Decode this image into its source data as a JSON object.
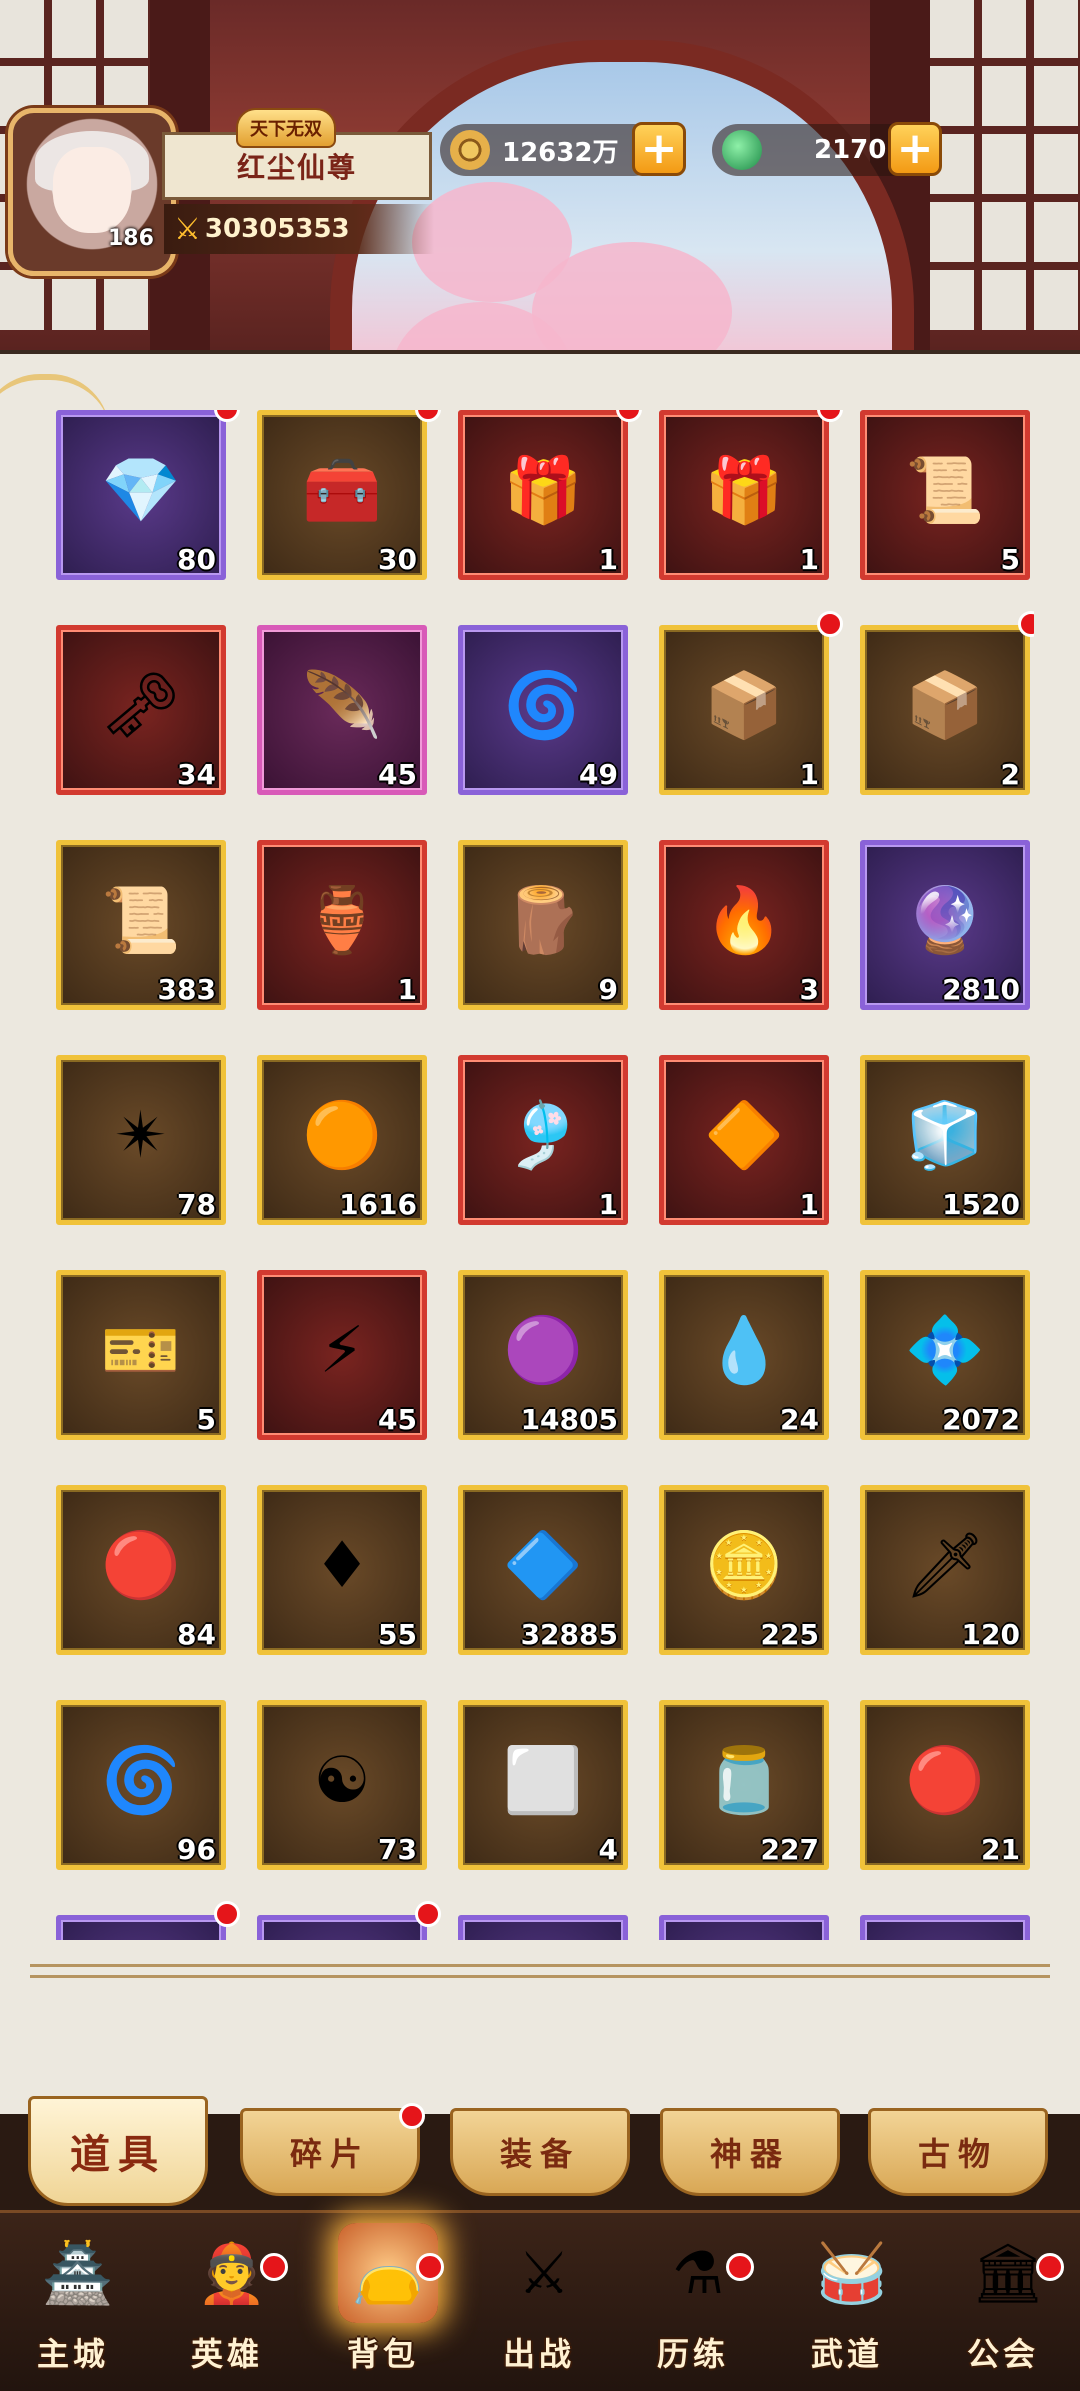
{
  "player": {
    "title_badge": "天下无双",
    "name": "红尘仙尊",
    "level": "186",
    "power": "30305353"
  },
  "currencies": [
    {
      "name": "copper-coin-icon",
      "value": "12632万",
      "color": "#c8902a"
    },
    {
      "name": "jade-icon",
      "value": "2170",
      "color": "#38b060"
    }
  ],
  "items": [
    {
      "icon": "purple-crystal-chest-icon",
      "glyph": "💎",
      "count": "80",
      "quality": "purple",
      "dot": true
    },
    {
      "icon": "gold-treasure-chest-icon",
      "glyph": "🧰",
      "count": "30",
      "quality": "gold",
      "dot": true
    },
    {
      "icon": "elite-god-chest-icon",
      "glyph": "🎁",
      "count": "1",
      "quality": "red",
      "dot": true
    },
    {
      "icon": "red-gift-chest-icon",
      "glyph": "🎁",
      "count": "1",
      "quality": "red",
      "dot": true
    },
    {
      "icon": "scroll-icon",
      "glyph": "📜",
      "count": "5",
      "quality": "red",
      "dot": false
    },
    {
      "icon": "silver-key-icon",
      "glyph": "🗝",
      "count": "34",
      "quality": "red",
      "dot": false
    },
    {
      "icon": "pink-feather-icon",
      "glyph": "🪶",
      "count": "45",
      "quality": "pink",
      "dot": false
    },
    {
      "icon": "orange-swirl-coin-icon",
      "glyph": "🌀",
      "count": "49",
      "quality": "purple",
      "dot": false
    },
    {
      "icon": "wooden-chest-doll-icon",
      "glyph": "📦",
      "count": "1",
      "quality": "gold",
      "dot": true
    },
    {
      "icon": "wooden-chest-doll-icon",
      "glyph": "📦",
      "count": "2",
      "quality": "gold",
      "dot": true
    },
    {
      "icon": "blue-scroll-icon",
      "glyph": "📜",
      "count": "383",
      "quality": "gold",
      "dot": false
    },
    {
      "icon": "white-vase-icon",
      "glyph": "🏺",
      "count": "1",
      "quality": "red",
      "dot": false
    },
    {
      "icon": "wood-plank-icon",
      "glyph": "🪵",
      "count": "9",
      "quality": "gold",
      "dot": false
    },
    {
      "icon": "fire-bead-icon",
      "glyph": "🔥",
      "count": "3",
      "quality": "red",
      "dot": false
    },
    {
      "icon": "blue-orb-icon",
      "glyph": "🔮",
      "count": "2810",
      "quality": "purple",
      "dot": false
    },
    {
      "icon": "cyan-relic-icon",
      "glyph": "✴",
      "count": "78",
      "quality": "gold",
      "dot": false
    },
    {
      "icon": "golden-orb-icon",
      "glyph": "🟠",
      "count": "1616",
      "quality": "gold",
      "dot": false
    },
    {
      "icon": "golden-cloth-icon",
      "glyph": "🎐",
      "count": "1",
      "quality": "red",
      "dot": false
    },
    {
      "icon": "fire-rune-stone-icon",
      "glyph": "🔶",
      "count": "1",
      "quality": "red",
      "dot": false
    },
    {
      "icon": "blue-cube-icon",
      "glyph": "🧊",
      "count": "1520",
      "quality": "gold",
      "dot": false
    },
    {
      "icon": "lottery-slip-icon",
      "glyph": "🎫",
      "count": "5",
      "quality": "gold",
      "dot": false
    },
    {
      "icon": "thunder-stone-icon",
      "glyph": "⚡",
      "count": "45",
      "quality": "red",
      "dot": false
    },
    {
      "icon": "purple-pearl-icon",
      "glyph": "🟣",
      "count": "14805",
      "quality": "gold",
      "dot": false
    },
    {
      "icon": "blue-flame-gem-icon",
      "glyph": "💧",
      "count": "24",
      "quality": "gold",
      "dot": false
    },
    {
      "icon": "blue-crystal-icon",
      "glyph": "💠",
      "count": "2072",
      "quality": "gold",
      "dot": false
    },
    {
      "icon": "red-orb-stand-icon",
      "glyph": "🔴",
      "count": "84",
      "quality": "gold",
      "dot": false
    },
    {
      "icon": "red-gem-icon",
      "glyph": "♦",
      "count": "55",
      "quality": "gold",
      "dot": false
    },
    {
      "icon": "blue-sand-pile-icon",
      "glyph": "🔷",
      "count": "32885",
      "quality": "gold",
      "dot": false
    },
    {
      "icon": "gold-medallion-icon",
      "glyph": "🪙",
      "count": "225",
      "quality": "gold",
      "dot": false
    },
    {
      "icon": "dagger-icon",
      "glyph": "🗡",
      "count": "120",
      "quality": "gold",
      "dot": false
    },
    {
      "icon": "orange-swirl-disc-icon",
      "glyph": "🌀",
      "count": "96",
      "quality": "gold",
      "dot": false
    },
    {
      "icon": "bagua-mirror-icon",
      "glyph": "☯",
      "count": "73",
      "quality": "gold",
      "dot": false
    },
    {
      "icon": "stone-tile-icon",
      "glyph": "⬜",
      "count": "4",
      "quality": "gold",
      "dot": false
    },
    {
      "icon": "glass-jar-icon",
      "glyph": "🫙",
      "count": "227",
      "quality": "gold",
      "dot": false
    },
    {
      "icon": "red-cloud-orb-icon",
      "glyph": "🔴",
      "count": "21",
      "quality": "gold",
      "dot": false
    },
    {
      "icon": "partial-item-icon",
      "glyph": "",
      "count": "",
      "quality": "purple",
      "dot": true
    },
    {
      "icon": "partial-item-icon",
      "glyph": "",
      "count": "",
      "quality": "purple",
      "dot": true
    },
    {
      "icon": "partial-item-icon",
      "glyph": "",
      "count": "",
      "quality": "purple",
      "dot": false
    },
    {
      "icon": "partial-item-icon",
      "glyph": "",
      "count": "",
      "quality": "purple",
      "dot": false
    },
    {
      "icon": "partial-item-icon",
      "glyph": "",
      "count": "",
      "quality": "purple",
      "dot": false
    }
  ],
  "tabs": [
    {
      "label": "道具",
      "active": true,
      "dot": false
    },
    {
      "label": "碎片",
      "active": false,
      "dot": true
    },
    {
      "label": "装备",
      "active": false,
      "dot": false
    },
    {
      "label": "神器",
      "active": false,
      "dot": false
    },
    {
      "label": "古物",
      "active": false,
      "dot": false
    }
  ],
  "nav": [
    {
      "label": "主城",
      "icon": "main-city-icon",
      "glyph": "🏯",
      "dot": false,
      "active": false
    },
    {
      "label": "英雄",
      "icon": "hero-icon",
      "glyph": "👲",
      "dot": true,
      "active": false
    },
    {
      "label": "背包",
      "icon": "bag-icon",
      "glyph": "👝",
      "dot": true,
      "active": true
    },
    {
      "label": "出战",
      "icon": "battle-icon",
      "glyph": "⚔",
      "dot": false,
      "active": false
    },
    {
      "label": "历练",
      "icon": "training-icon",
      "glyph": "⚗",
      "dot": true,
      "active": false
    },
    {
      "label": "武道",
      "icon": "martial-icon",
      "glyph": "🥁",
      "dot": false,
      "active": false
    },
    {
      "label": "公会",
      "icon": "guild-icon",
      "glyph": "🏛",
      "dot": true,
      "active": false
    }
  ]
}
